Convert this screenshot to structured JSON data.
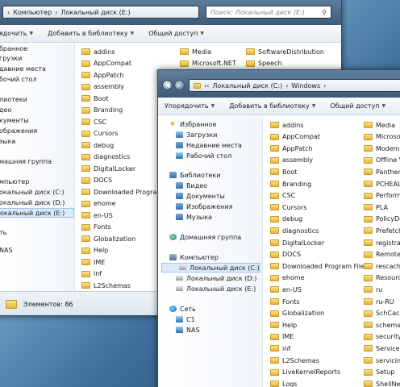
{
  "back_window": {
    "breadcrumb": [
      "Компьютер",
      "Локальный диск (E:)"
    ],
    "search_placeholder": "Поиск: Локальный диск (E:)",
    "toolbar": {
      "organize": "упорядочить",
      "add_library": "Добавить в библиотеку",
      "share": "Общий доступ"
    },
    "nav_items": [
      "бранное",
      "грузки",
      "давние места",
      "бочий стол",
      "лиотеки",
      "део",
      "кументы",
      "ображения",
      "зыка",
      "машняя группа",
      "мпьютер",
      "окальный диск (C:)",
      "окальный диск (D:)",
      "окальный диск (E:)",
      "ть",
      "NAS"
    ],
    "nav_selected_index": 13,
    "col1": [
      "addins",
      "AppCompat",
      "AppPatch",
      "assembly",
      "Boot",
      "Branding",
      "CSC",
      "Cursors",
      "debug",
      "diagnostics",
      "DigitalLocker",
      "DOCS",
      "Downloaded Program F",
      "ehome",
      "en-US",
      "Fonts",
      "Globalization",
      "Help",
      "IME",
      "inf",
      "L2Schemas",
      "LiveKernelReports",
      "Logs"
    ],
    "col2": [
      "Media",
      "Microsoft.NET"
    ],
    "col3": [
      "SoftwareDistribution",
      "Speech"
    ],
    "status": "Элементов: 86"
  },
  "front_window": {
    "breadcrumb": [
      "Локальный диск (C:)",
      "Windows"
    ],
    "toolbar": {
      "organize": "Упорядочить",
      "add_library": "Добавить в библиотеку",
      "share": "Общий доступ"
    },
    "nav": {
      "favorites_header": "Избранное",
      "favorites": [
        "Загрузки",
        "Недавние места",
        "Рабочий стол"
      ],
      "libraries_header": "Библиотеки",
      "libraries": [
        "Видео",
        "Документы",
        "Изображения",
        "Музыка"
      ],
      "homegroup": "Домашняя группа",
      "computer_header": "Компьютер",
      "drives": [
        "Локальный диск (C:)",
        "Локальный диск (D:)",
        "Локальный диск (E:)"
      ],
      "network_header": "Сеть",
      "network": [
        "C1",
        "NAS"
      ]
    },
    "col1": [
      "addins",
      "AppCompat",
      "AppPatch",
      "assembly",
      "Boot",
      "Branding",
      "CSC",
      "Cursors",
      "debug",
      "diagnostics",
      "DigitalLocker",
      "DOCS",
      "Downloaded Program Files",
      "ehome",
      "en-US",
      "Fonts",
      "Globalization",
      "Help",
      "IME",
      "inf",
      "L2Schemas",
      "LiveKernelReports",
      "Logs"
    ],
    "col2": [
      "Media",
      "Microsof",
      "ModemL",
      "Offline W",
      "Panther",
      "PCHEALT",
      "Perform",
      "PLA",
      "PolicyDe",
      "Prefetch",
      "registrat",
      "RemoteP",
      "rescache",
      "Resourc",
      "ru",
      "ru-RU",
      "SchCach",
      "schemas",
      "security",
      "ServiceP",
      "servicing",
      "Setup",
      "ShellNew"
    ]
  }
}
